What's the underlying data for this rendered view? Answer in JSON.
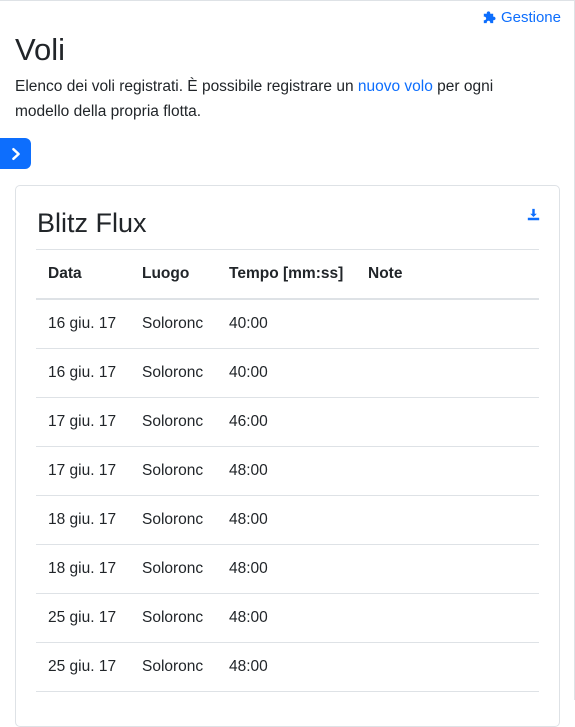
{
  "header": {
    "manage_label": "Gestione",
    "manage_icon": "puzzle-piece-icon"
  },
  "page": {
    "title": "Voli",
    "intro_before": "Elenco dei voli registrati. È possibile registrare un ",
    "intro_link": "nuovo volo",
    "intro_after": " per ogni modello della propria flotta."
  },
  "sidebar_toggle": {
    "icon": "chevron-right-icon"
  },
  "card": {
    "title": "Blitz Flux",
    "download_icon": "download-icon",
    "table": {
      "columns": [
        "Data",
        "Luogo",
        "Tempo [mm:ss]",
        "Note"
      ],
      "rows": [
        [
          "16 giu. 17",
          "Soloronc",
          "40:00",
          ""
        ],
        [
          "16 giu. 17",
          "Soloronc",
          "40:00",
          ""
        ],
        [
          "17 giu. 17",
          "Soloronc",
          "46:00",
          ""
        ],
        [
          "17 giu. 17",
          "Soloronc",
          "48:00",
          ""
        ],
        [
          "18 giu. 17",
          "Soloronc",
          "48:00",
          ""
        ],
        [
          "18 giu. 17",
          "Soloronc",
          "48:00",
          ""
        ],
        [
          "25 giu. 17",
          "Soloronc",
          "48:00",
          ""
        ],
        [
          "25 giu. 17",
          "Soloronc",
          "48:00",
          ""
        ]
      ]
    }
  },
  "colors": {
    "accent": "#0d6efd",
    "text": "#212529",
    "border": "#dee2e6"
  }
}
